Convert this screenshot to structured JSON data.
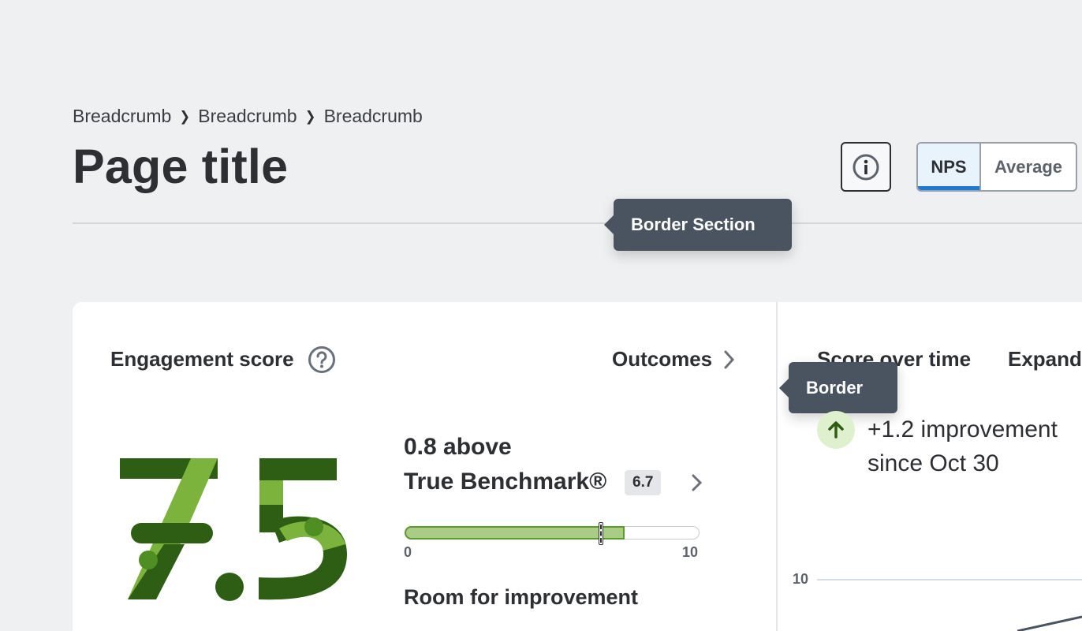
{
  "breadcrumb": [
    "Breadcrumb",
    "Breadcrumb",
    "Breadcrumb"
  ],
  "page_title": "Page title",
  "header": {
    "info_icon": "info-icon",
    "toggle": {
      "active": "NPS",
      "inactive": "Average"
    }
  },
  "tooltips": {
    "section": "Border Section",
    "border": "Border"
  },
  "engagement": {
    "label": "Engagement score",
    "help_icon": "question-icon",
    "outcomes_link": "Outcomes",
    "score": "7.5",
    "delta_line1": "0.8 above",
    "delta_line2": "True Benchmark®",
    "benchmark_value": "6.7",
    "bar": {
      "min": "0",
      "max": "10",
      "value": 7.5,
      "benchmark": 6.7
    },
    "room_label": "Room for improvement"
  },
  "score_over_time": {
    "title": "Score over time",
    "expand_label": "Expand",
    "improvement_line1": "+1.2 improvement",
    "improvement_line2": "since Oct 30",
    "y_axis_top": "10"
  },
  "colors": {
    "score_dark": "#2e5e14",
    "score_light": "#7bb33c",
    "accent_blue": "#1f7ad6",
    "tooltip_bg": "#4a5360"
  }
}
